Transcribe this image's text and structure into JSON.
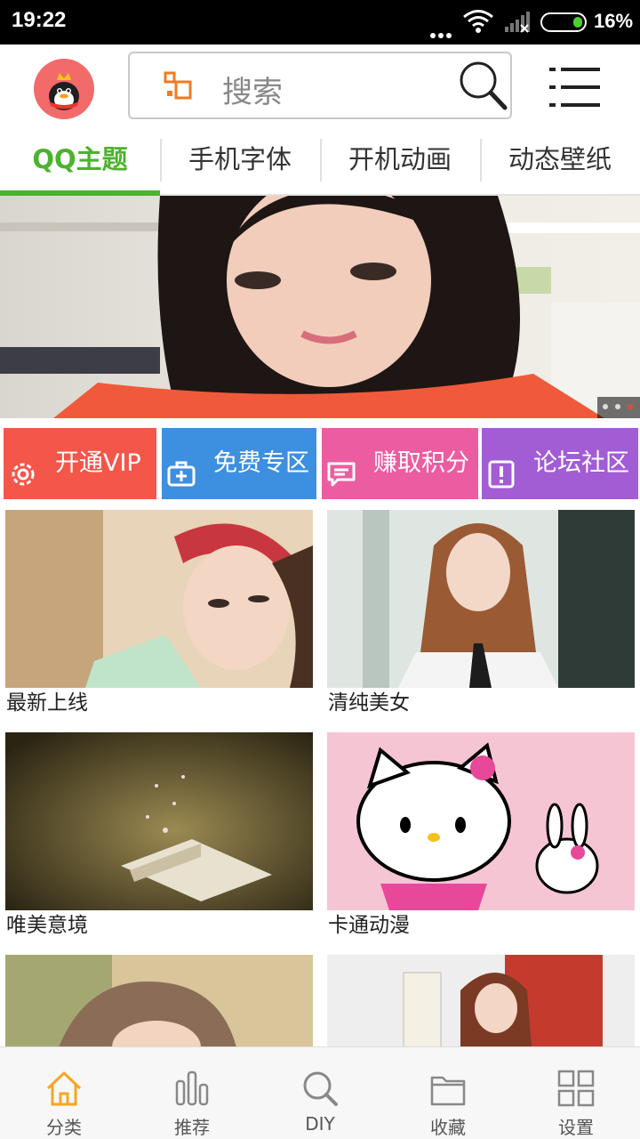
{
  "status_bar": {
    "time": "19:22",
    "battery": "16%"
  },
  "search": {
    "placeholder": "搜索"
  },
  "tabs": [
    {
      "label": "QQ主题",
      "active": true
    },
    {
      "label": "手机字体",
      "active": false
    },
    {
      "label": "开机动画",
      "active": false
    },
    {
      "label": "动态壁纸",
      "active": false
    }
  ],
  "banner": {
    "page_count": 3,
    "current_page": 3
  },
  "features": [
    {
      "label": "开通VIP",
      "icon": "gear-icon",
      "color": "#f4564a"
    },
    {
      "label": "免费专区",
      "icon": "medkit-icon",
      "color": "#3d8fe0"
    },
    {
      "label": "赚取积分",
      "icon": "chat-icon",
      "color": "#ec5ca0"
    },
    {
      "label": "论坛社区",
      "icon": "alert-icon",
      "color": "#a25cd4"
    }
  ],
  "categories": [
    {
      "label": "最新上线"
    },
    {
      "label": "清纯美女"
    },
    {
      "label": "唯美意境"
    },
    {
      "label": "卡通动漫"
    },
    {
      "label": ""
    },
    {
      "label": ""
    }
  ],
  "bottom_nav": [
    {
      "label": "分类",
      "icon": "home-icon",
      "active": true
    },
    {
      "label": "推荐",
      "icon": "bar-chart-icon",
      "active": false
    },
    {
      "label": "DIY",
      "icon": "search-icon",
      "active": false
    },
    {
      "label": "收藏",
      "icon": "folder-icon",
      "active": false
    },
    {
      "label": "设置",
      "icon": "grid-icon",
      "active": false
    }
  ],
  "colors": {
    "accent": "#4cb22f",
    "nav_active": "#f5a623"
  }
}
